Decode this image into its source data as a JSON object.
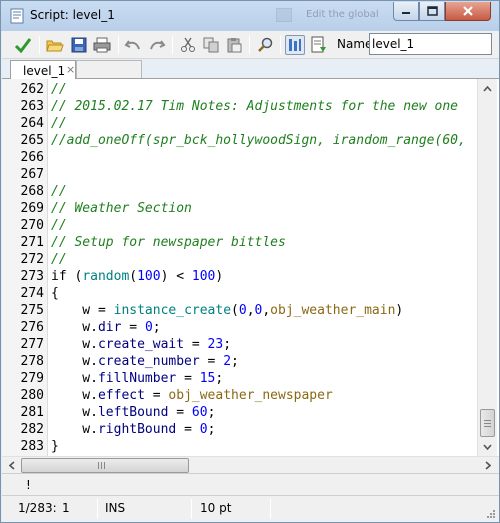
{
  "window": {
    "title": "Script: level_1",
    "background_title": "Edit the global"
  },
  "toolbar": {
    "buttons": [
      "ok-check",
      "open-folder",
      "save-disk",
      "print",
      "undo",
      "redo",
      "cut",
      "copy",
      "paste",
      "find-magnifier",
      "ruler-toggle",
      "snippet-insert"
    ],
    "name_label": "Name:",
    "name_value": "level_1"
  },
  "tabs": [
    {
      "label": "level_1",
      "close": "×",
      "active": true
    },
    {
      "label": "",
      "active": false
    }
  ],
  "editor": {
    "lines": [
      {
        "num": "262",
        "tokens": [
          {
            "t": "//",
            "c": "comment"
          }
        ]
      },
      {
        "num": "263",
        "tokens": [
          {
            "t": "// 2015.02.17 Tim Notes: Adjustments for the new one",
            "c": "comment"
          }
        ]
      },
      {
        "num": "264",
        "tokens": [
          {
            "t": "//",
            "c": "comment"
          }
        ]
      },
      {
        "num": "265",
        "tokens": [
          {
            "t": "//add_oneOff(spr_bck_hollywoodSign, irandom_range(60,",
            "c": "comment"
          }
        ]
      },
      {
        "num": "266",
        "tokens": []
      },
      {
        "num": "267",
        "tokens": []
      },
      {
        "num": "268",
        "tokens": [
          {
            "t": "//",
            "c": "comment"
          }
        ]
      },
      {
        "num": "269",
        "tokens": [
          {
            "t": "// Weather Section",
            "c": "comment"
          }
        ]
      },
      {
        "num": "270",
        "tokens": [
          {
            "t": "//",
            "c": "comment"
          }
        ]
      },
      {
        "num": "271",
        "tokens": [
          {
            "t": "// Setup for newspaper bittles",
            "c": "comment"
          }
        ]
      },
      {
        "num": "272",
        "tokens": [
          {
            "t": "//",
            "c": "comment"
          }
        ]
      },
      {
        "num": "273",
        "tokens": [
          {
            "t": "if",
            "c": "keyword"
          },
          {
            "t": " (",
            "c": "op"
          },
          {
            "t": "random",
            "c": "builtin"
          },
          {
            "t": "(",
            "c": "op"
          },
          {
            "t": "100",
            "c": "number"
          },
          {
            "t": ") < ",
            "c": "op"
          },
          {
            "t": "100",
            "c": "number"
          },
          {
            "t": ")",
            "c": "op"
          }
        ]
      },
      {
        "num": "274",
        "tokens": [
          {
            "t": "{",
            "c": "op"
          }
        ]
      },
      {
        "num": "275",
        "tokens": [
          {
            "t": "    w = ",
            "c": "plain"
          },
          {
            "t": "instance_create",
            "c": "builtin"
          },
          {
            "t": "(",
            "c": "op"
          },
          {
            "t": "0",
            "c": "number"
          },
          {
            "t": ",",
            "c": "op"
          },
          {
            "t": "0",
            "c": "number"
          },
          {
            "t": ",",
            "c": "op"
          },
          {
            "t": "obj_weather_main",
            "c": "resource"
          },
          {
            "t": ")",
            "c": "op"
          }
        ]
      },
      {
        "num": "276",
        "tokens": [
          {
            "t": "    w.",
            "c": "plain"
          },
          {
            "t": "dir",
            "c": "variable"
          },
          {
            "t": " = ",
            "c": "op"
          },
          {
            "t": "0",
            "c": "number"
          },
          {
            "t": ";",
            "c": "op"
          }
        ]
      },
      {
        "num": "277",
        "tokens": [
          {
            "t": "    w.",
            "c": "plain"
          },
          {
            "t": "create_wait",
            "c": "variable"
          },
          {
            "t": " = ",
            "c": "op"
          },
          {
            "t": "23",
            "c": "number"
          },
          {
            "t": ";",
            "c": "op"
          }
        ]
      },
      {
        "num": "278",
        "tokens": [
          {
            "t": "    w.",
            "c": "plain"
          },
          {
            "t": "create_number",
            "c": "variable"
          },
          {
            "t": " = ",
            "c": "op"
          },
          {
            "t": "2",
            "c": "number"
          },
          {
            "t": ";",
            "c": "op"
          }
        ]
      },
      {
        "num": "279",
        "tokens": [
          {
            "t": "    w.",
            "c": "plain"
          },
          {
            "t": "fillNumber",
            "c": "variable"
          },
          {
            "t": " = ",
            "c": "op"
          },
          {
            "t": "15",
            "c": "number"
          },
          {
            "t": ";",
            "c": "op"
          }
        ]
      },
      {
        "num": "280",
        "tokens": [
          {
            "t": "    w.",
            "c": "plain"
          },
          {
            "t": "effect",
            "c": "variable"
          },
          {
            "t": " = ",
            "c": "op"
          },
          {
            "t": "obj_weather_newspaper",
            "c": "resource"
          }
        ]
      },
      {
        "num": "281",
        "tokens": [
          {
            "t": "    w.",
            "c": "plain"
          },
          {
            "t": "leftBound",
            "c": "variable"
          },
          {
            "t": " = ",
            "c": "op"
          },
          {
            "t": "60",
            "c": "number"
          },
          {
            "t": ";",
            "c": "op"
          }
        ]
      },
      {
        "num": "282",
        "tokens": [
          {
            "t": "    w.",
            "c": "plain"
          },
          {
            "t": "rightBound",
            "c": "variable"
          },
          {
            "t": " = ",
            "c": "op"
          },
          {
            "t": "0",
            "c": "number"
          },
          {
            "t": ";",
            "c": "op"
          }
        ]
      },
      {
        "num": "283",
        "tokens": [
          {
            "t": "}",
            "c": "op"
          }
        ]
      }
    ]
  },
  "message_bar": {
    "text": "!"
  },
  "status_bar": {
    "position": "1/283:",
    "column": "1",
    "mode": "INS",
    "font_size": "10 pt"
  },
  "colors": {
    "comment": "#1f7f1f",
    "builtin": "#008080",
    "number": "#0000ff",
    "resource": "#8b6914",
    "variable": "#000080"
  }
}
